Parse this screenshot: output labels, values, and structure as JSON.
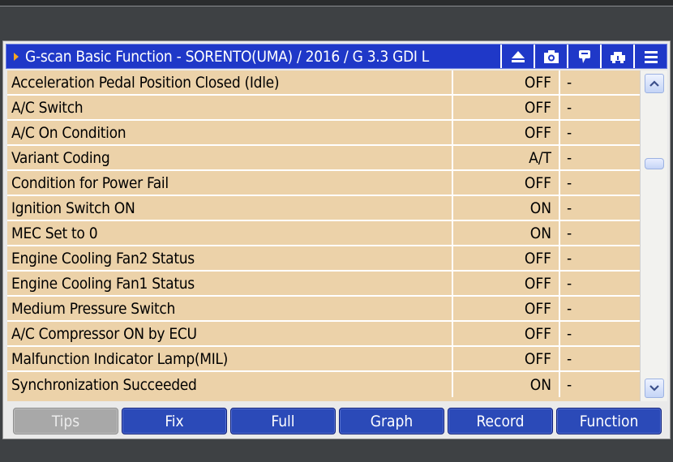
{
  "window": {
    "title": "G-scan Basic Function - SORENTO(UMA) / 2016 / G 3.3 GDI L"
  },
  "toolbar_icons": [
    "eject-icon",
    "camera-icon",
    "chat-icon",
    "vehicle-icon",
    "menu-icon"
  ],
  "table": {
    "rows": [
      {
        "name": "Acceleration Pedal Position Closed (Idle)",
        "value": "OFF",
        "unit": "-"
      },
      {
        "name": "A/C Switch",
        "value": "OFF",
        "unit": "-"
      },
      {
        "name": "A/C On Condition",
        "value": "OFF",
        "unit": "-"
      },
      {
        "name": "Variant Coding",
        "value": "A/T",
        "unit": "-"
      },
      {
        "name": "Condition for Power Fail",
        "value": "OFF",
        "unit": "-"
      },
      {
        "name": "Ignition Switch ON",
        "value": "ON",
        "unit": "-"
      },
      {
        "name": "MEC Set to 0",
        "value": "ON",
        "unit": "-"
      },
      {
        "name": "Engine Cooling Fan2 Status",
        "value": "OFF",
        "unit": "-"
      },
      {
        "name": "Engine Cooling Fan1 Status",
        "value": "OFF",
        "unit": "-"
      },
      {
        "name": "Medium Pressure Switch",
        "value": "OFF",
        "unit": "-"
      },
      {
        "name": "A/C Compressor ON by ECU",
        "value": "OFF",
        "unit": "-"
      },
      {
        "name": "Malfunction Indicator Lamp(MIL)",
        "value": "OFF",
        "unit": "-"
      },
      {
        "name": "Synchronization Succeeded",
        "value": "ON",
        "unit": "-"
      }
    ]
  },
  "buttons": {
    "tips": "Tips",
    "fix": "Fix",
    "full": "Full",
    "graph": "Graph",
    "record": "Record",
    "function": "Function"
  },
  "colors": {
    "title_bar": "#1f38c8",
    "row_background": "#ecd2a9",
    "button": "#2b4ab8",
    "button_disabled": "#a8a8a8",
    "accent_arrow": "#f5a623"
  }
}
